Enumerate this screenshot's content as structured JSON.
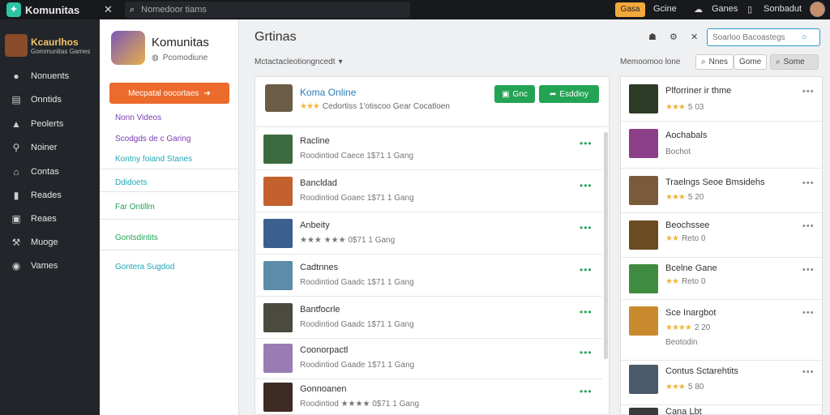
{
  "colors": {
    "accent_orange": "#ec6a2b",
    "accent_green": "#23a455",
    "link_blue": "#2a7fb8",
    "dark_nav": "#222529",
    "topbar": "#17191c",
    "star": "#f0b63c"
  },
  "topbar": {
    "brand": "Komunitas",
    "brand_icon": "komunitas-logo-icon",
    "close_icon": "close-icon",
    "search_placeholder": "Nomedoor tiams",
    "cta": "Gasa",
    "links": [
      "Gcine",
      "Ganes",
      "Sonbadut"
    ]
  },
  "leftnav": {
    "logo_title": "Kcaurlhos",
    "logo_sub": "Gommunitas Games",
    "items": [
      {
        "label": "Nonuents",
        "icon": "user-icon"
      },
      {
        "label": "Onntids",
        "icon": "book-icon"
      },
      {
        "label": "Peolerts",
        "icon": "bag-icon"
      },
      {
        "label": "Noiner",
        "icon": "wrench-icon"
      },
      {
        "label": "Contas",
        "icon": "shop-icon"
      },
      {
        "label": "Reades",
        "icon": "chart-icon"
      },
      {
        "label": "Reaes",
        "icon": "image-icon"
      },
      {
        "label": "Muoge",
        "icon": "tools-icon"
      },
      {
        "label": "Vames",
        "icon": "gamepad-icon"
      }
    ]
  },
  "secnav": {
    "profile_name": "Komunitas",
    "profile_sub": "Pcomodiune",
    "cta": "Mecpatal oocortaes",
    "links": [
      {
        "label": "Nonn Videos",
        "color": "#7a3cb0"
      },
      {
        "label": "Scodgds de c Garing",
        "color": "#7a3cb0"
      },
      {
        "label": "Kontny foiand Stanes",
        "color": "#20a7b5"
      },
      {
        "label": "Ddidoets",
        "color": "#20a7b5"
      },
      {
        "label": "Far Ontillm",
        "color": "#23a455"
      },
      {
        "label": "Gontsdintits",
        "color": "#23a455"
      },
      {
        "label": "Gontera Sugdod",
        "color": "#20a7b5"
      }
    ]
  },
  "main": {
    "title": "Grtinas",
    "sort_label": "Mctactacleotiongncedt",
    "featured": {
      "title": "Koma Online",
      "stars": "★★★",
      "meta": "Cedortiss 1'otiscoo Gear Cocatloen",
      "btn1": "Gnc",
      "btn2": "Esddioy"
    },
    "rows": [
      {
        "title": "Racline",
        "meta": "Roodintiod Caece 1$71 1 Gang",
        "pic": "#3c6b3f"
      },
      {
        "title": "Bancldad",
        "meta": "Roodintiod Goaec 1$71 1 Gang",
        "pic": "#c4602e"
      },
      {
        "title": "Anbeity",
        "meta": "★★★  ★★★  0$71 1 Gang",
        "pic": "#3b5f8f"
      },
      {
        "title": "Cadtnnes",
        "meta": "Roodintiod Gaadc 1$71 1 Gang",
        "pic": "#5c8ca8"
      },
      {
        "title": "Bantfocrle",
        "meta": "Roodintiod Gaadc 1$71 1 Gang",
        "pic": "#4a4a3f"
      },
      {
        "title": "Coonorpactl",
        "meta": "Roodintiod Gaade 1$71 1 Gang",
        "pic": "#9a7cb3"
      },
      {
        "title": "Gonnoanen",
        "meta": "Roodintiod ★★★★  0$71 1 Gang",
        "pic": "#3d2b24"
      }
    ]
  },
  "side": {
    "list_label": "Memoomoo lone",
    "search_placeholder": "Soarloo Bacoastegs",
    "filters": [
      "Nnes",
      "Gome",
      "Some"
    ],
    "rows": [
      {
        "title": "Plforriner ir thme",
        "stars": "★★★",
        "meta": "5 03",
        "pic": "#2c3b26"
      },
      {
        "title": "Aochabals",
        "stars": "",
        "meta": "Bochot",
        "pic": "#8a3f88"
      },
      {
        "title": "Traelngs Seoe Bmsidehs",
        "stars": "★★★",
        "meta": "5 20",
        "pic": "#7a5a3a"
      },
      {
        "title": "Beochssee",
        "stars": "★★",
        "meta": "Reto 0",
        "pic": "#6a4b22"
      },
      {
        "title": "Bcelne Gane",
        "stars": "★★",
        "meta": "Reto 0",
        "pic": "#3f8b3f"
      },
      {
        "title": "Sce Inargbot",
        "stars": "★★★★",
        "meta": "2 20",
        "pic": "#c98a2e"
      },
      {
        "title": "Contus Sctarehtits",
        "stars": "★★★",
        "meta": "5 80",
        "pic": "#4a5a6a"
      },
      {
        "title": "Cana Lbt",
        "stars": "",
        "meta": "",
        "pic": "#3a3a3a"
      }
    ],
    "rows_extra": "Beotodin"
  }
}
